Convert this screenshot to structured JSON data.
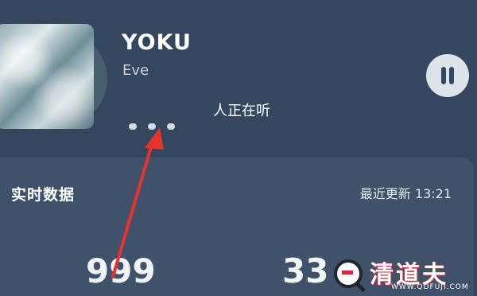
{
  "player": {
    "song_title": "YOKU",
    "artist": "Eve",
    "listeners_text": "人正在听"
  },
  "realtime": {
    "title": "实时数据",
    "updated": "最近更新 13:21",
    "stats": [
      "999",
      "33"
    ]
  },
  "watermark": {
    "name": "清道夫",
    "url": "WWW.QDFUJI.COM"
  },
  "colors": {
    "background": "#33465f",
    "card": "#3f526a",
    "annotation_arrow": "#e8322e"
  },
  "icons": {
    "pause": "pause-icon"
  }
}
